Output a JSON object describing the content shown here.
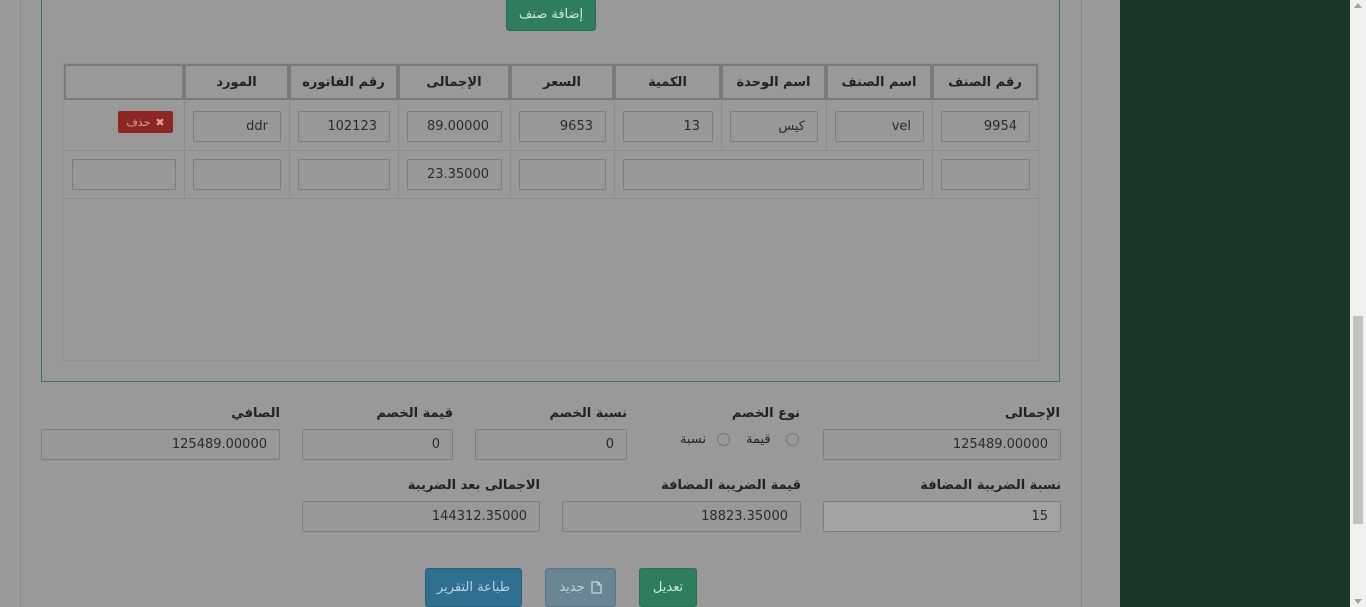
{
  "buttons": {
    "add_item": "إضافة صنف",
    "delete": "حذف",
    "edit": "تعديل",
    "new": "جديد",
    "print_report": "طباعة التقرير"
  },
  "table": {
    "headers": [
      "رقم الصنف",
      "اسم الصنف",
      "اسم الوحدة",
      "الكمية",
      "السعر",
      "الإجمالى",
      "رقم الفاتوره",
      "المورد",
      ""
    ],
    "row1": {
      "item_no": "9954",
      "item_name": "vel",
      "unit_name": "كيس",
      "quantity": "13",
      "price": "9653",
      "total": "89.00000",
      "invoice_no": "102123",
      "supplier": "ddr"
    },
    "row2": {
      "total": "23.35000"
    }
  },
  "summary": {
    "total_label": "الإجمالى",
    "total_value": "125489.00000",
    "discount_type_label": "نوع الخصم",
    "discount_type_value": "قيمة",
    "discount_type_percent": "نسبة",
    "discount_rate_label": "نسبة الخصم",
    "discount_rate_value": "0",
    "discount_value_label": "قيمة الخصم",
    "discount_value_value": "0",
    "net_label": "الصافي",
    "net_value": "125489.00000",
    "vat_rate_label": "نسبة الضريبة المضافة",
    "vat_rate_value": "15",
    "vat_value_label": "قيمة الضريبة المضافة",
    "vat_value_value": "18823.35000",
    "total_after_tax_label": "الاجمالى بعد الضريبة",
    "total_after_tax_value": "144312.35000"
  },
  "colors": {
    "accent_green": "#2e7d5d",
    "sidebar": "#1c3628",
    "delete_red": "#8e2723",
    "info_blue": "#2f6f8f"
  }
}
